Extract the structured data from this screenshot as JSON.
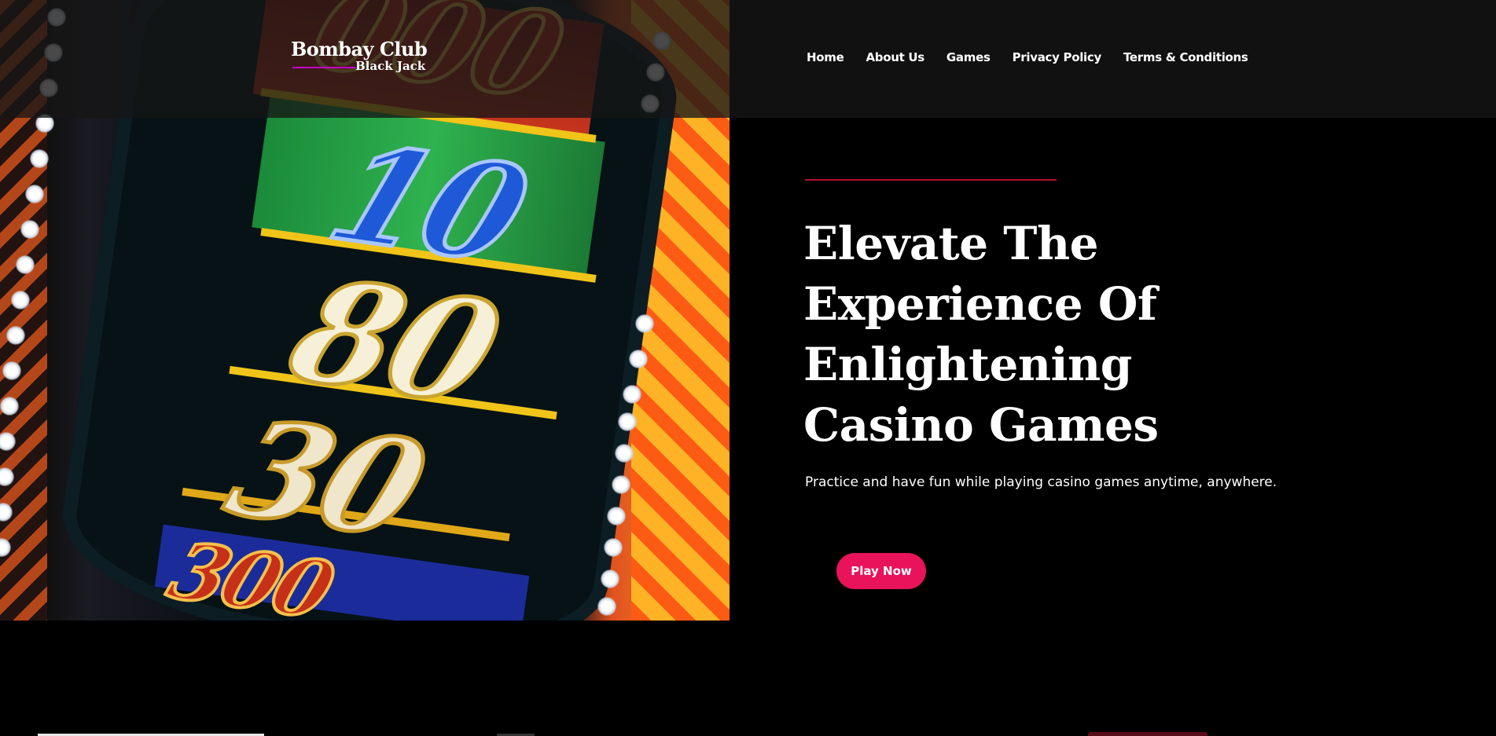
{
  "header": {
    "logo": {
      "title": "Bombay Club",
      "subtitle": "Black Jack"
    },
    "nav": [
      {
        "label": "Home"
      },
      {
        "label": "About Us"
      },
      {
        "label": "Games"
      },
      {
        "label": "Privacy Policy"
      },
      {
        "label": "Terms & Conditions"
      }
    ]
  },
  "hero": {
    "title_lines": [
      "Elevate The",
      "Experience Of",
      "Enlightening",
      "Casino Games"
    ],
    "subtitle": "Practice and have fun while playing casino games anytime, anywhere.",
    "cta_label": "Play Now",
    "image_numbers": [
      "000",
      "10",
      "80",
      "30",
      "300"
    ]
  },
  "colors": {
    "background": "#000000",
    "accent_line": "#b3122a",
    "cta": "#e8135a",
    "logo_underline": "#c800c8"
  }
}
